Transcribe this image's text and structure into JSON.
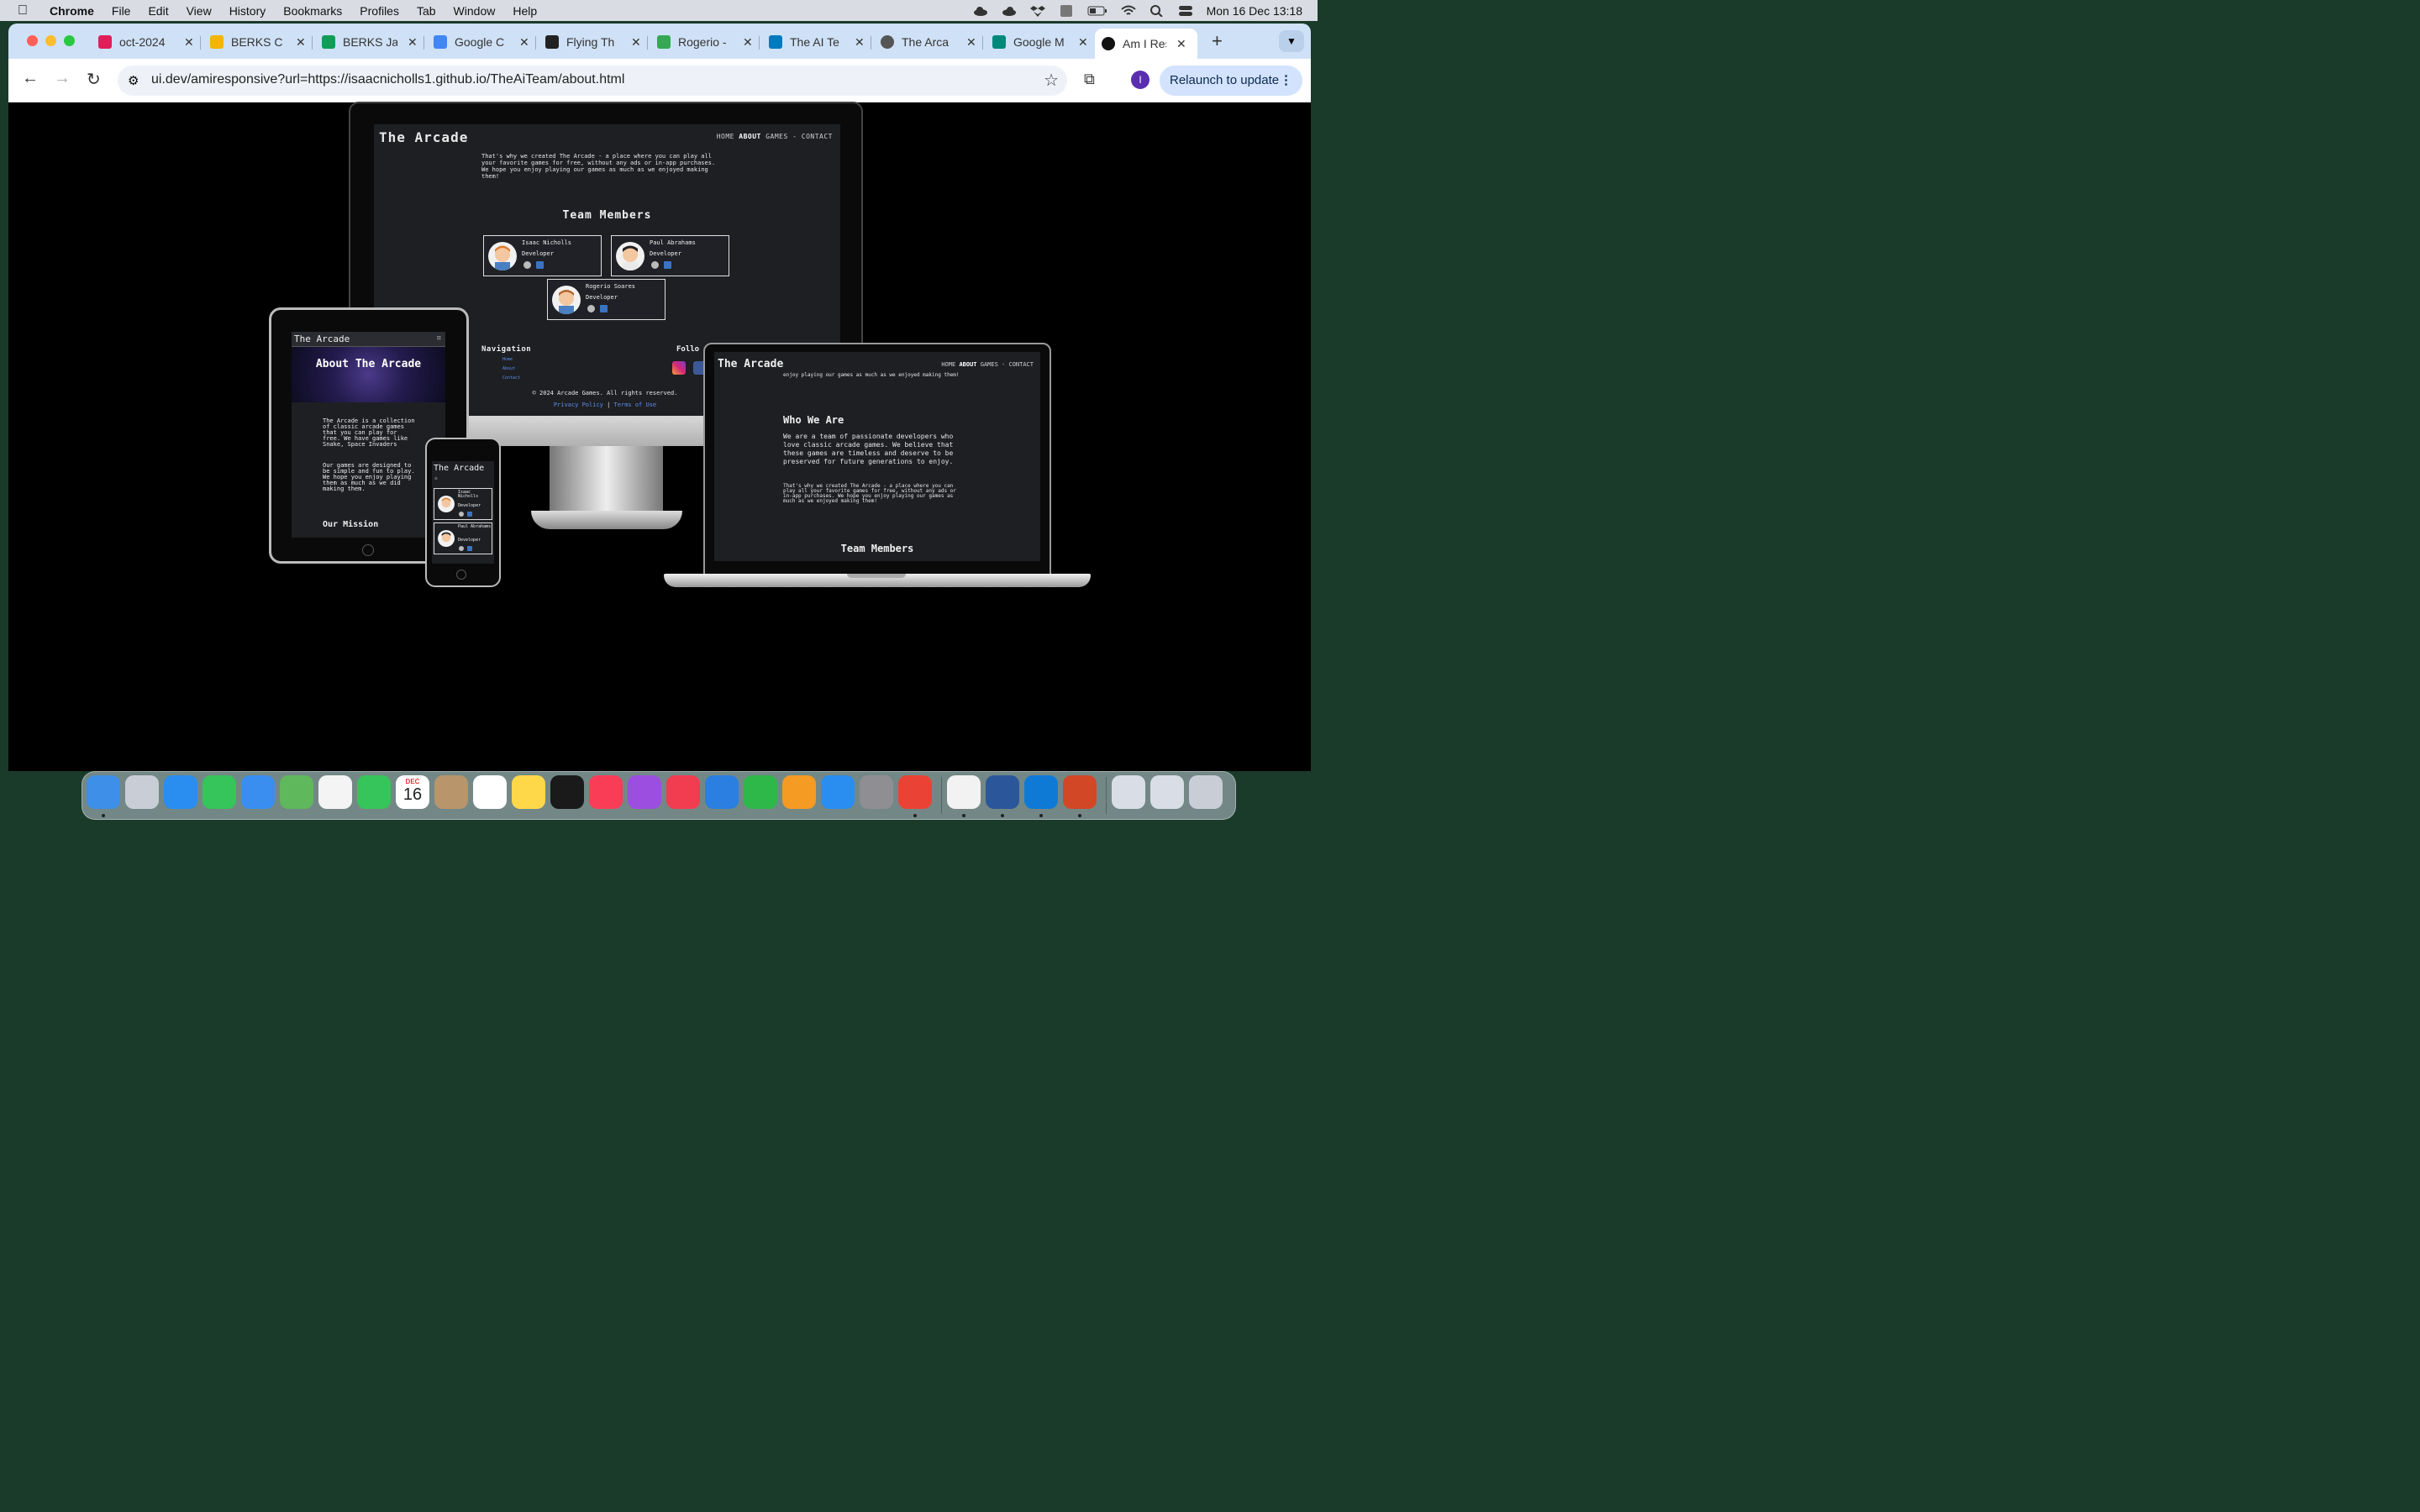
{
  "menubar": {
    "app": "Chrome",
    "items": [
      "File",
      "Edit",
      "View",
      "History",
      "Bookmarks",
      "Profiles",
      "Tab",
      "Window",
      "Help"
    ],
    "datetime": "Mon 16 Dec  13:18"
  },
  "tabs": [
    {
      "title": "oct-2024",
      "fav_color": "#e01e5a"
    },
    {
      "title": "BERKS C",
      "fav_color": "#f4b400"
    },
    {
      "title": "BERKS Ja",
      "fav_color": "#0f9d58"
    },
    {
      "title": "Google C",
      "fav_color": "#4285f4"
    },
    {
      "title": "Flying Th",
      "fav_color": "#222222"
    },
    {
      "title": "Rogerio -",
      "fav_color": "#34a853"
    },
    {
      "title": "The AI Te",
      "fav_color": "#0079bf"
    },
    {
      "title": "The Arca",
      "fav_color": "#555555"
    },
    {
      "title": "Google M",
      "fav_color": "#00897b"
    },
    {
      "title": "Am I Res",
      "fav_color": "#111111"
    }
  ],
  "toolbar": {
    "url": "ui.dev/amiresponsive?url=https://isaacnicholls1.github.io/TheAiTeam/about.html",
    "profile_initial": "I",
    "relaunch_label": "Relaunch to update"
  },
  "site": {
    "logo": "The Arcade",
    "nav": {
      "home": "HOME",
      "about": "ABOUT",
      "games": "GAMES",
      "dash": "-",
      "contact": "CONTACT"
    },
    "intro": "That's why we created The Arcade - a place where you can play all your favorite games for free, without any ads or in-app purchases. We hope you enjoy playing our games as much as we enjoyed making them!",
    "team_title": "Team Members",
    "members": [
      {
        "name": "Isaac Nicholls",
        "role": "Developer"
      },
      {
        "name": "Paul Abrahams",
        "role": "Developer"
      },
      {
        "name": "Rogerio Soares",
        "role": "Developer"
      }
    ],
    "footer": {
      "nav_title": "Navigation",
      "nav_links": [
        "Home",
        "About",
        "Contact"
      ],
      "follow_title": "Follo",
      "copyright": "© 2024 Arcade Games. All rights reserved.",
      "privacy": "Privacy Policy",
      "separator": "|",
      "terms": "Terms of Use"
    }
  },
  "tablet": {
    "logo": "The Arcade",
    "burger": "≡",
    "hero_title": "About The Arcade",
    "p1": "The Arcade is a collection of classic arcade games that you can play for free. We have games like Snake, Space Invaders",
    "p2": "Our games are designed to be simple and fun to play. We hope you enjoy playing them as much as we did making them.",
    "mission": "Our Mission"
  },
  "phone": {
    "logo": "The Arcade",
    "burger": "≡",
    "members": [
      {
        "name": "Isaac Nicholls",
        "role": "Developer"
      },
      {
        "name": "Paul Abrahams",
        "role": "Developer"
      }
    ]
  },
  "laptop": {
    "logo": "The Arcade",
    "top_text": "enjoy playing our games as much as we enjoyed making them!",
    "who_title": "Who We Are",
    "who_text": "We are a team of passionate developers who love classic arcade games. We believe that these games are timeless and deserve to be preserved for future generations to enjoy.",
    "small_text": "That's why we created The Arcade - a place where you can play all your favorite games for free, without any ads or in-app purchases. We hope you enjoy playing our games as much as we enjoyed making them!",
    "team_title": "Team Members"
  },
  "dock": {
    "apps": [
      {
        "name": "finder-icon",
        "color": "#3d8fe8"
      },
      {
        "name": "launchpad-icon",
        "color": "#c9cdd6"
      },
      {
        "name": "safari-icon",
        "color": "#2a8df0"
      },
      {
        "name": "messages-icon",
        "color": "#36c55a"
      },
      {
        "name": "mail-icon",
        "color": "#3a8ef0"
      },
      {
        "name": "maps-icon",
        "color": "#5fb85c"
      },
      {
        "name": "photos-icon",
        "color": "#f4f4f4"
      },
      {
        "name": "facetime-icon",
        "color": "#36c55a"
      },
      {
        "name": "calendar-icon",
        "color": "#ffffff"
      },
      {
        "name": "contacts-icon",
        "color": "#b8956a"
      },
      {
        "name": "reminders-icon",
        "color": "#ffffff"
      },
      {
        "name": "notes-icon",
        "color": "#ffd84a"
      },
      {
        "name": "tv-icon",
        "color": "#1a1a1a"
      },
      {
        "name": "music-icon",
        "color": "#fa3d56"
      },
      {
        "name": "podcasts-icon",
        "color": "#9b4ee0"
      },
      {
        "name": "news-icon",
        "color": "#f23c4f"
      },
      {
        "name": "keynote-icon",
        "color": "#2a7fe0"
      },
      {
        "name": "numbers-icon",
        "color": "#2fb84a"
      },
      {
        "name": "pages-icon",
        "color": "#f59a23"
      },
      {
        "name": "app-store-icon",
        "color": "#2a8df0"
      },
      {
        "name": "system-settings-icon",
        "color": "#8e8e93"
      },
      {
        "name": "chrome-icon",
        "color": "#ea4335"
      },
      {
        "name": "face-icon",
        "color": "#f2f2f2"
      },
      {
        "name": "word-icon",
        "color": "#2b579a"
      },
      {
        "name": "vscode-icon",
        "color": "#0f7ad6"
      },
      {
        "name": "powerpoint-icon",
        "color": "#d24726"
      },
      {
        "name": "screenshot-1-icon",
        "color": "#d8dde6"
      },
      {
        "name": "screenshot-2-icon",
        "color": "#d8dde6"
      },
      {
        "name": "trash-icon",
        "color": "#c9ced6"
      }
    ],
    "calendar": {
      "month": "DEC",
      "day": "16"
    }
  }
}
